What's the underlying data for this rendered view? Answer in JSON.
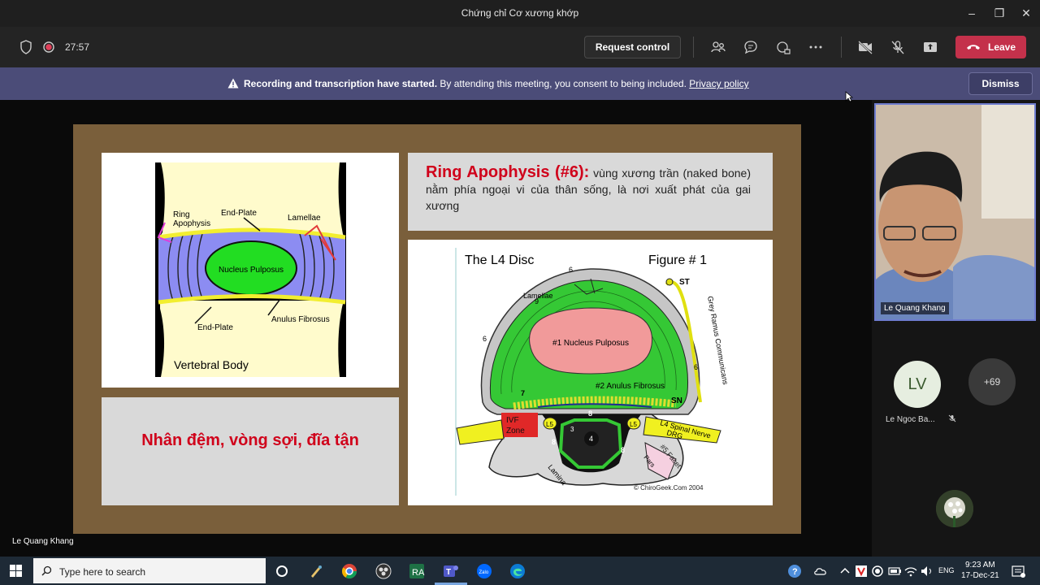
{
  "window": {
    "title": "Chứng chỉ Cơ xương khớp"
  },
  "toolbar": {
    "timer": "27:57",
    "request_control": "Request control",
    "leave": "Leave"
  },
  "banner": {
    "bold": "Recording and transcription have started.",
    "text": " By attending this meeting, you consent to being included. ",
    "link": "Privacy policy",
    "dismiss": "Dismiss"
  },
  "slide": {
    "left_diagram": {
      "ring_apophysis": "Ring",
      "ring_apophysis2": "Apophysis",
      "end_plate_top": "End-Plate",
      "lamellae": "Lamellae",
      "nucleus": "Nucleus Pulposus",
      "end_plate_bottom": "End-Plate",
      "anulus": "Anulus Fibrosus",
      "caption": "Vertebral Body"
    },
    "ring_title": "Ring Apophysis (#6):",
    "ring_text": " vùng xương trần (naked bone) nằm phía ngoại vi của thân sống, là nơi xuất phát của gai xương",
    "viet_title": "Nhân đệm, vòng sợi, đĩa tận",
    "figure": {
      "title": "The L4 Disc",
      "figure_no": "Figure # 1",
      "nucleus": "#1 Nucleus Pulposus",
      "anulus": "#2 Anulus Fibrosus",
      "lamellae": "Lamellae",
      "st": "ST",
      "sn": "SN",
      "grey_ramus": "Grey Ramus Communicans",
      "ivf": "IVF",
      "zone": "Zone",
      "l5_left": "L5",
      "l5_right": "L5",
      "spinal_nerve": "L4 Spinal Nerve",
      "drg": "DRG",
      "facet": "#5 Facet",
      "pars": "Pars",
      "lamina": "Lamina",
      "copyright": "© ChiroGeek.Com 2004",
      "n6a": "6",
      "n6b": "6",
      "n6c": "6",
      "n9": "9",
      "n7": "7",
      "n8a": "8",
      "n8b": "8",
      "n8c": "8",
      "n4": "4",
      "n3": "3"
    }
  },
  "presenter_label": "Le Quang Khang",
  "rail": {
    "video_name": "Le Quang Khang",
    "lv_initials": "LV",
    "lv_name": "Le Ngoc Ba...",
    "more_count": "+69"
  },
  "taskbar": {
    "search_placeholder": "Type here to search",
    "lang": "ENG",
    "time": "9:23 AM",
    "date": "17-Dec-21"
  },
  "colors": {
    "teams_banner": "#4b4c78",
    "leave_red": "#c4314b",
    "slide_frame": "#7a5f3b",
    "title_red": "#d0021b"
  }
}
